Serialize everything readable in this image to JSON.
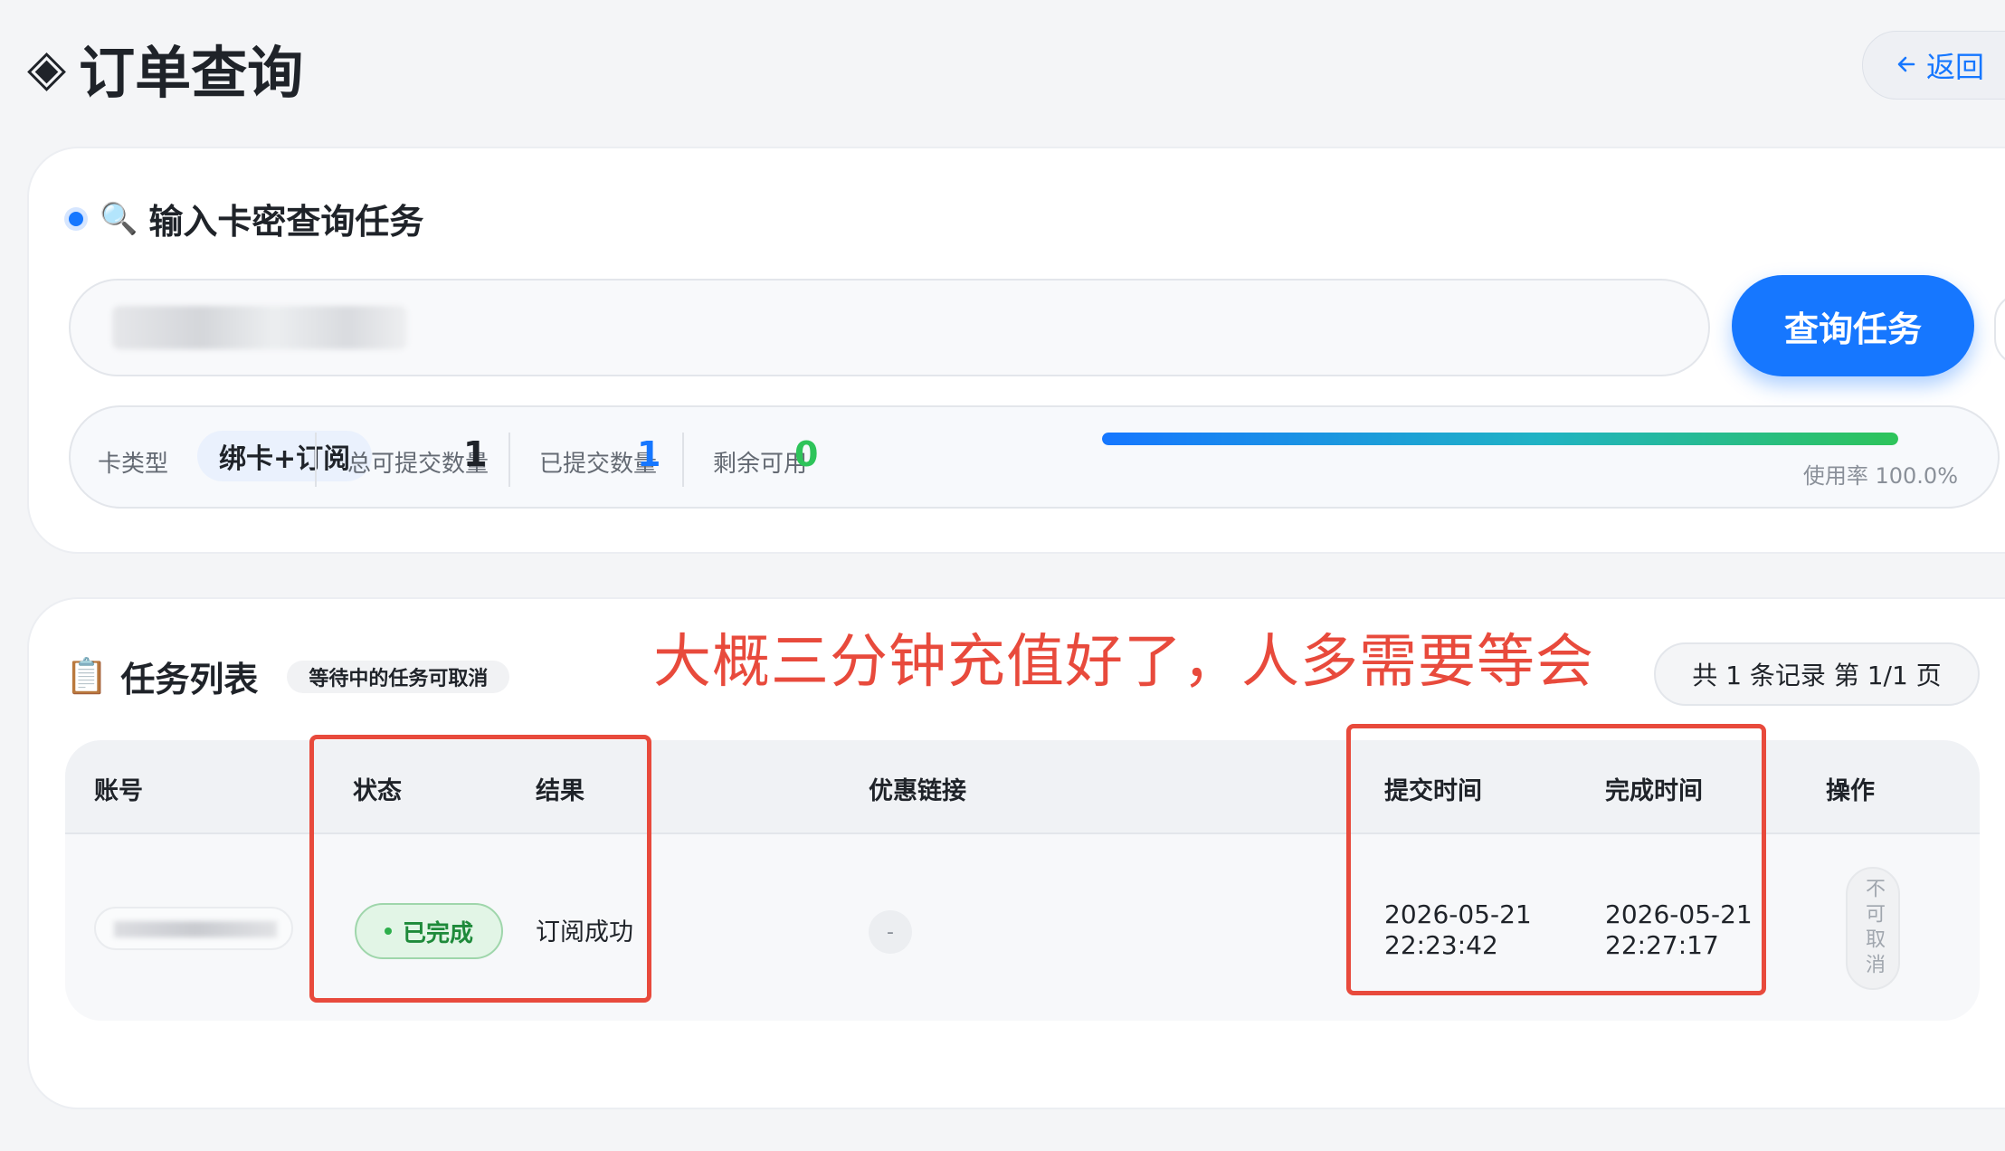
{
  "header": {
    "icon": "◈",
    "title": "订单查询",
    "back_label": "返回"
  },
  "search": {
    "section_title": "输入卡密查询任务",
    "query_button": "查询任务"
  },
  "stats": {
    "card_type_label": "卡类型",
    "card_type_value": "绑卡+订阅",
    "total_label": "总可提交数量",
    "total_value": "1",
    "submitted_label": "已提交数量",
    "submitted_value": "1",
    "remaining_label": "剩余可用",
    "remaining_value": "0",
    "usage_text": "使用率 100.0%",
    "usage_fraction": 1.0
  },
  "tasks": {
    "title": "任务列表",
    "hint": "等待中的任务可取消",
    "annotation": "大概三分钟充值好了，人多需要等会",
    "count_text": "共 1 条记录 第 1/1 页",
    "columns": {
      "account": "账号",
      "status": "状态",
      "result": "结果",
      "promo": "优惠链接",
      "submit_time": "提交时间",
      "complete_time": "完成时间",
      "action": "操作"
    },
    "row": {
      "status": "已完成",
      "result": "订阅成功",
      "promo": "-",
      "submit_time": "2026-05-21\n22:23:42",
      "complete_time": "2026-05-21\n22:27:17",
      "action": "不可取消"
    }
  },
  "colors": {
    "accent": "#1677ff",
    "success": "#2ec45a",
    "annotation_red": "#e84a3c"
  }
}
